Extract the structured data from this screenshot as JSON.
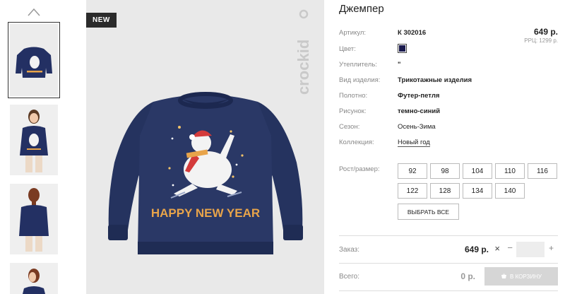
{
  "badge": "NEW",
  "brand": "crockid",
  "product": {
    "title": "Джемпер",
    "print_text": "HAPPY NEW YEAR",
    "attributes": [
      {
        "key": "Артикул:",
        "value": "К 302016"
      },
      {
        "key": "Цвет:",
        "value": ""
      },
      {
        "key": "Утеплитель:",
        "value": "\""
      },
      {
        "key": "Вид изделия:",
        "value": "Трикотажные изделия"
      },
      {
        "key": "Полотно:",
        "value": "Футер-петля"
      },
      {
        "key": "Рисунок:",
        "value": "темно-синий"
      },
      {
        "key": "Сезон:",
        "value": "Осень-Зима"
      },
      {
        "key": "Коллекция:",
        "value": "Новый год"
      }
    ],
    "color_hex": "#1a1a4e",
    "price": "649 р.",
    "rrp": "РРЦ: 1299 р."
  },
  "sizes": {
    "label": "Рост/размер:",
    "options": [
      "92",
      "98",
      "104",
      "110",
      "116",
      "122",
      "128",
      "134",
      "140"
    ],
    "select_all": "ВЫБРАТЬ ВСЕ"
  },
  "order": {
    "label": "Заказ:",
    "price": "649 р.",
    "times": "×",
    "minus": "−",
    "plus": "+",
    "qty": ""
  },
  "total": {
    "label": "Всего:",
    "value": "0 р.",
    "cart_button": "В КОРЗИНУ"
  }
}
